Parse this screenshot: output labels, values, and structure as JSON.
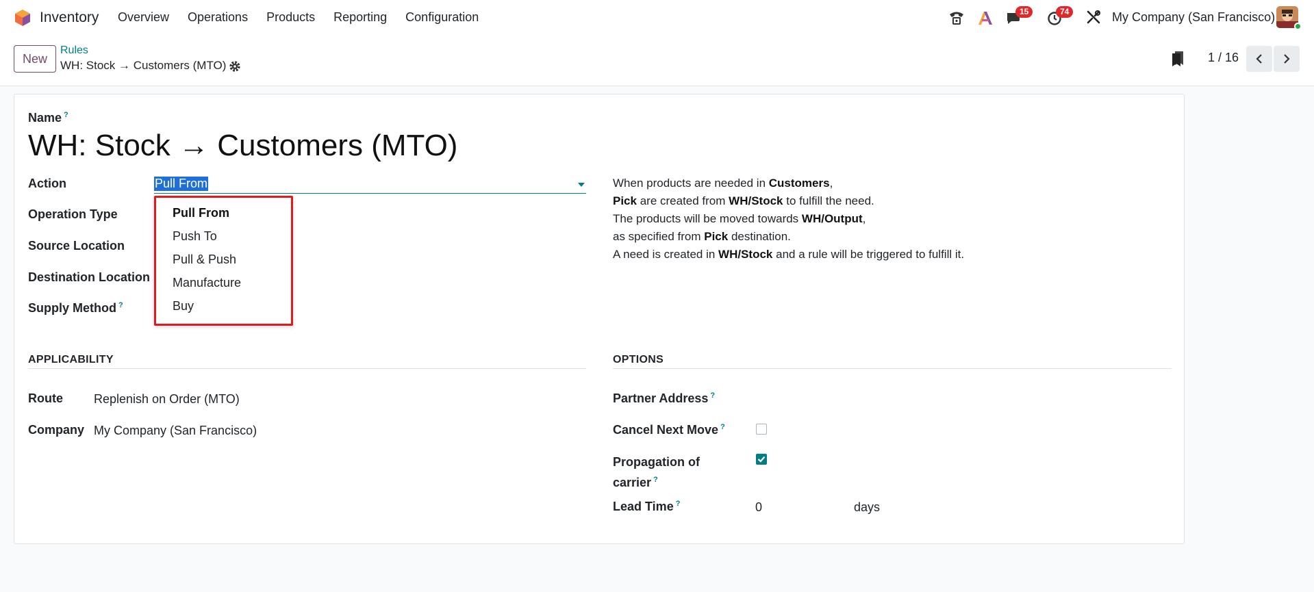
{
  "app": {
    "name": "Inventory",
    "menu": [
      "Overview",
      "Operations",
      "Products",
      "Reporting",
      "Configuration"
    ],
    "messages_badge": "15",
    "activities_badge": "74",
    "company": "My Company (San Francisco)"
  },
  "control": {
    "new_label": "New",
    "breadcrumb_parent": "Rules",
    "breadcrumb_current": "WH: Stock → Customers (MTO)",
    "pager": "1 / 16"
  },
  "form": {
    "name_label": "Name",
    "name_value": "WH: Stock → Customers (MTO)",
    "action_label": "Action",
    "action_value": "Pull From",
    "operation_type_label": "Operation Type",
    "source_location_label": "Source Location",
    "destination_location_label": "Destination Location",
    "supply_method_label": "Supply Method",
    "action_options": [
      "Pull From",
      "Push To",
      "Pull & Push",
      "Manufacture",
      "Buy"
    ],
    "help": {
      "l1a": "When products are needed in ",
      "l1b": "Customers",
      "l1c": ",",
      "l2a": "Pick",
      "l2b": " are created from ",
      "l2c": "WH/Stock",
      "l2d": " to fulfill the need.",
      "l3a": "The products will be moved towards ",
      "l3b": "WH/Output",
      "l3c": ",",
      "l4a": "as specified from ",
      "l4b": "Pick",
      "l4c": " destination.",
      "l5a": "A need is created in ",
      "l5b": "WH/Stock",
      "l5c": " and a rule will be triggered to fulfill it."
    },
    "applicability": {
      "title": "APPLICABILITY",
      "route_label": "Route",
      "route_value": "Replenish on Order (MTO)",
      "company_label": "Company",
      "company_value": "My Company (San Francisco)"
    },
    "options": {
      "title": "OPTIONS",
      "partner_address_label": "Partner Address",
      "cancel_next_move_label": "Cancel Next Move",
      "propagation_label_1": "Propagation of",
      "propagation_label_2": "carrier",
      "lead_time_label": "Lead Time",
      "lead_time_value": "0",
      "lead_time_unit": "days"
    }
  },
  "colors": {
    "brand": "#714b67",
    "accent": "#017e84",
    "highlight_box": "#e11b1b",
    "badge": "#e0272b"
  }
}
